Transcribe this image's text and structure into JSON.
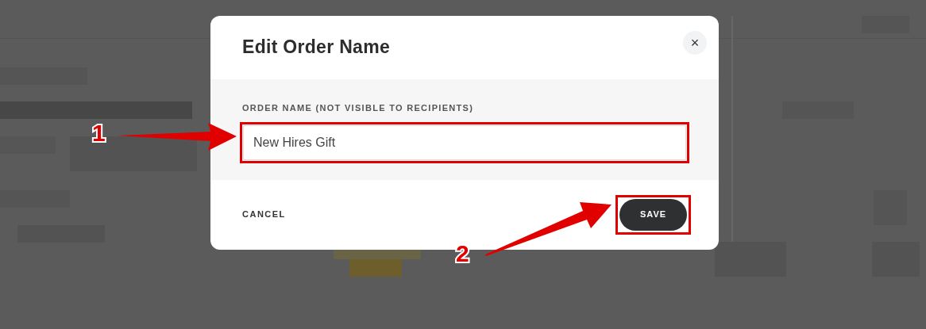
{
  "dialog": {
    "title": "Edit Order Name",
    "close": "×",
    "field": {
      "label": "ORDER NAME (NOT VISIBLE TO RECIPIENTS)",
      "value": "New Hires Gift",
      "highlighted": true
    },
    "buttons": [
      {
        "label": "CANCEL",
        "kind": "text",
        "highlighted": false
      },
      {
        "label": "SAVE",
        "kind": "primary",
        "highlighted": true
      }
    ]
  },
  "annotations": [
    {
      "number": "1"
    },
    {
      "number": "2"
    }
  ]
}
